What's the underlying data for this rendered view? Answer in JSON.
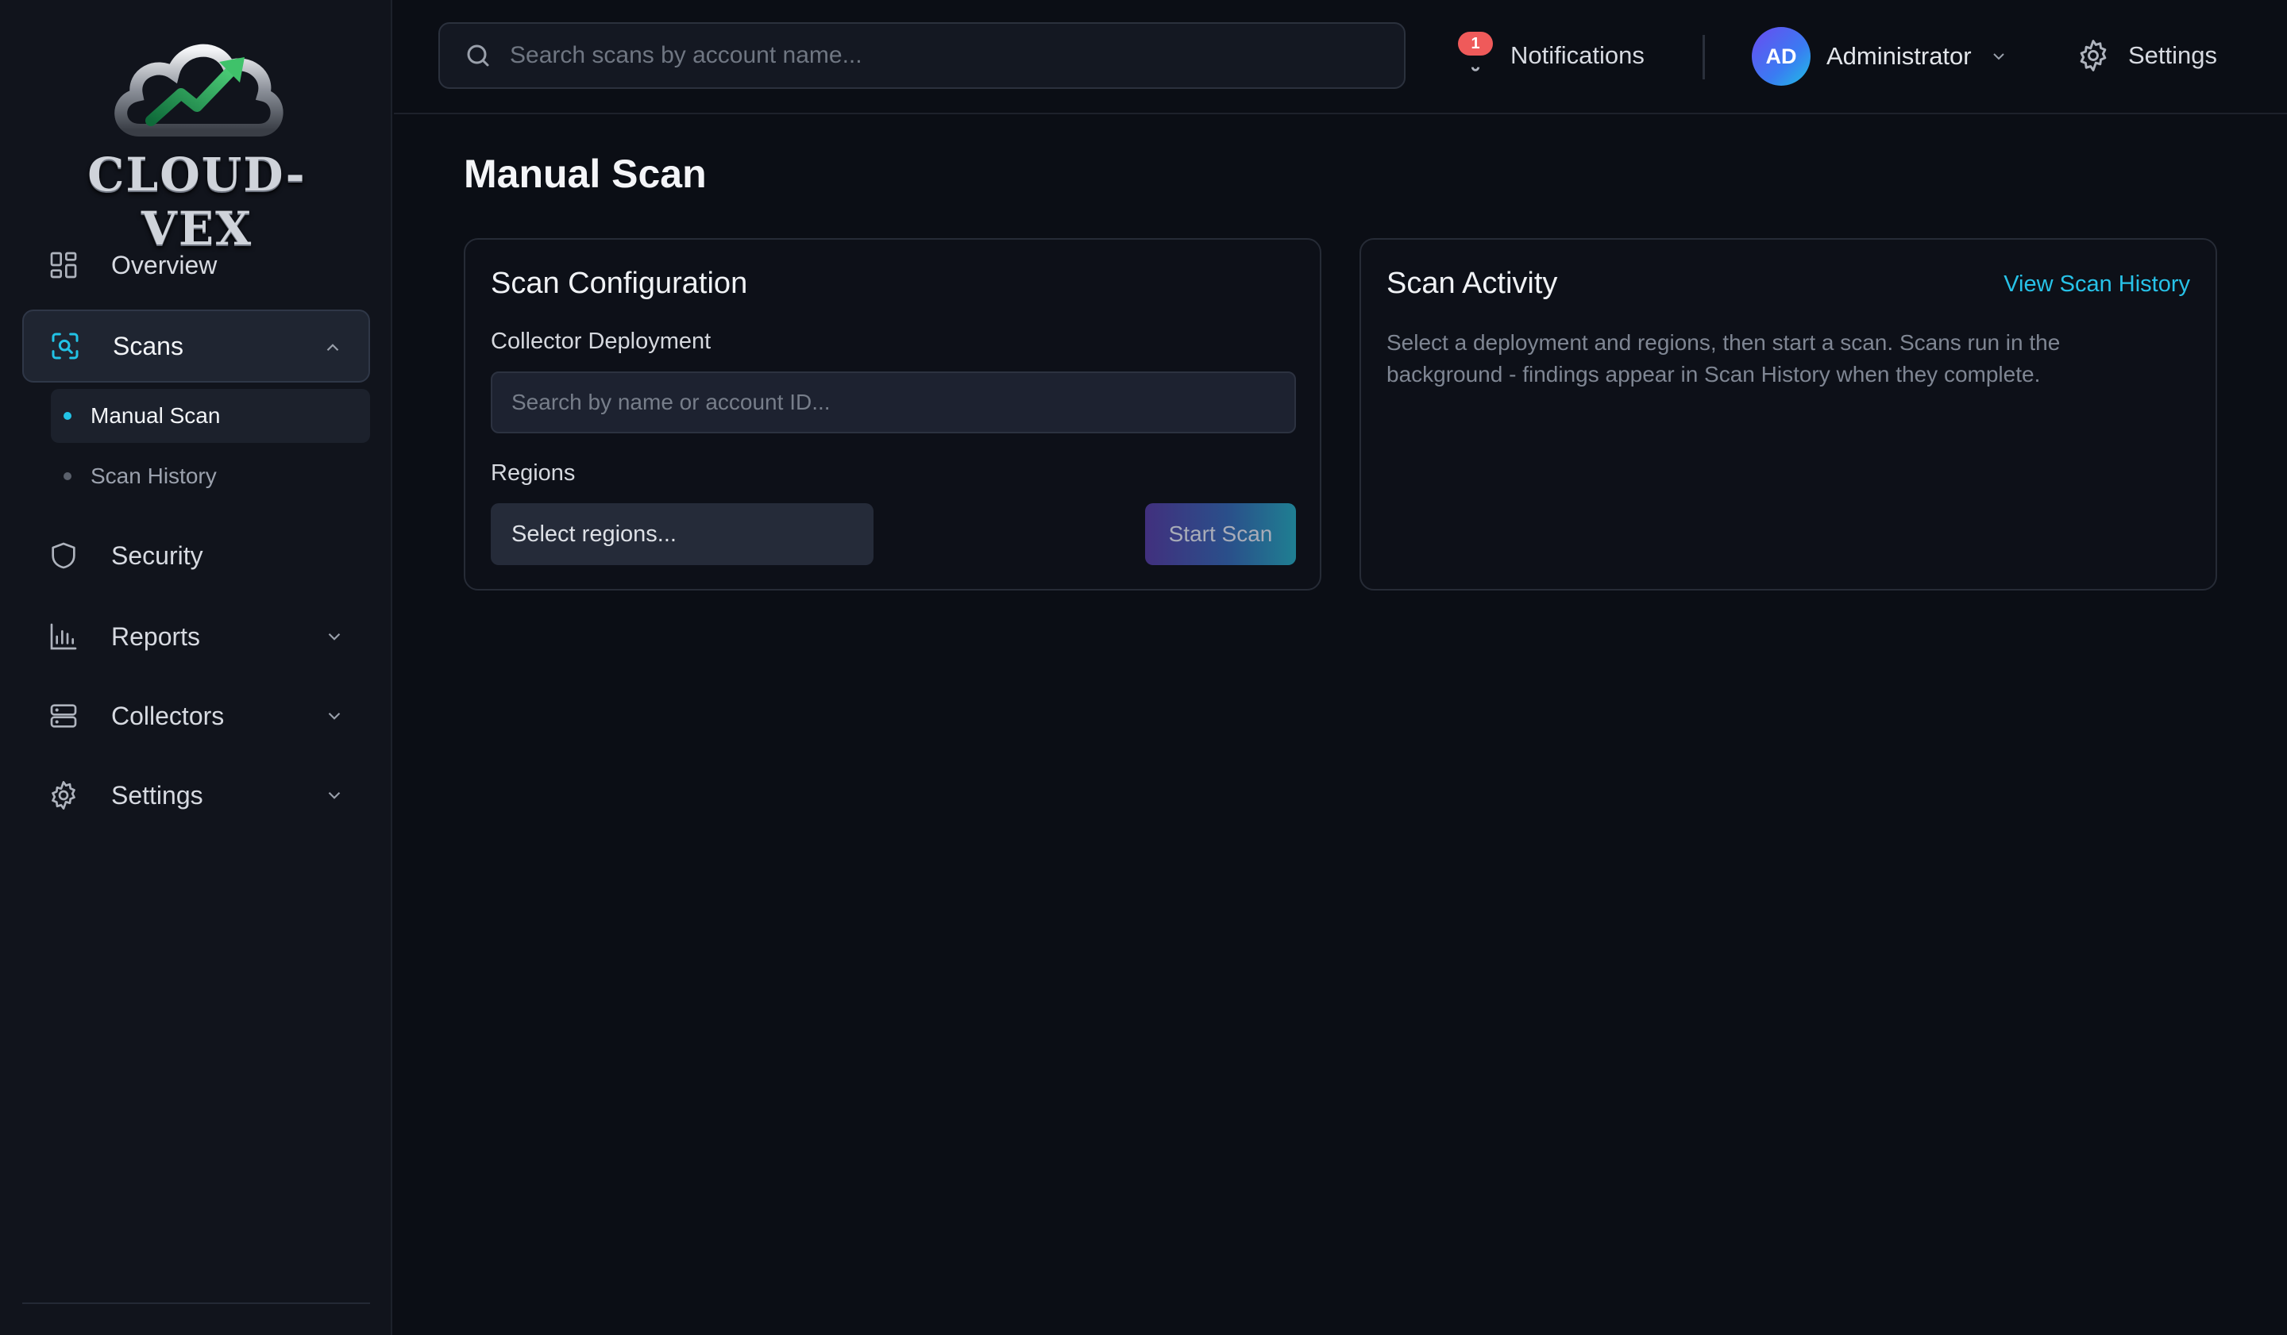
{
  "brand": {
    "name": "CLOUD-VEX"
  },
  "sidebar": {
    "items": [
      {
        "label": "Overview",
        "icon": "grid-icon"
      },
      {
        "label": "Scans",
        "icon": "scan-icon"
      },
      {
        "label": "Security",
        "icon": "shield-icon"
      },
      {
        "label": "Reports",
        "icon": "bar-chart-icon"
      },
      {
        "label": "Collectors",
        "icon": "server-icon"
      },
      {
        "label": "Settings",
        "icon": "gear-icon"
      }
    ],
    "scans_sub": [
      {
        "label": "Manual Scan"
      },
      {
        "label": "Scan History"
      }
    ]
  },
  "header": {
    "search_placeholder": "Search scans by account name...",
    "notifications_label": "Notifications",
    "notifications_count": "1",
    "user_initials": "AD",
    "user_name": "Administrator",
    "settings_label": "Settings"
  },
  "main": {
    "title": "Manual Scan",
    "config": {
      "title": "Scan Configuration",
      "deployment_label": "Collector Deployment",
      "deployment_placeholder": "Search by name or account ID...",
      "regions_label": "Regions",
      "regions_placeholder": "Select regions...",
      "start_label": "Start Scan"
    },
    "activity": {
      "title": "Scan Activity",
      "history_link": "View Scan History",
      "description": "Select a deployment and regions, then start a scan. Scans run in the background - findings appear in Scan History when they complete."
    }
  },
  "colors": {
    "accent": "#22c3e6",
    "background": "#0b0e15",
    "sidebar": "#11141c",
    "badge": "#ef5a5a"
  }
}
